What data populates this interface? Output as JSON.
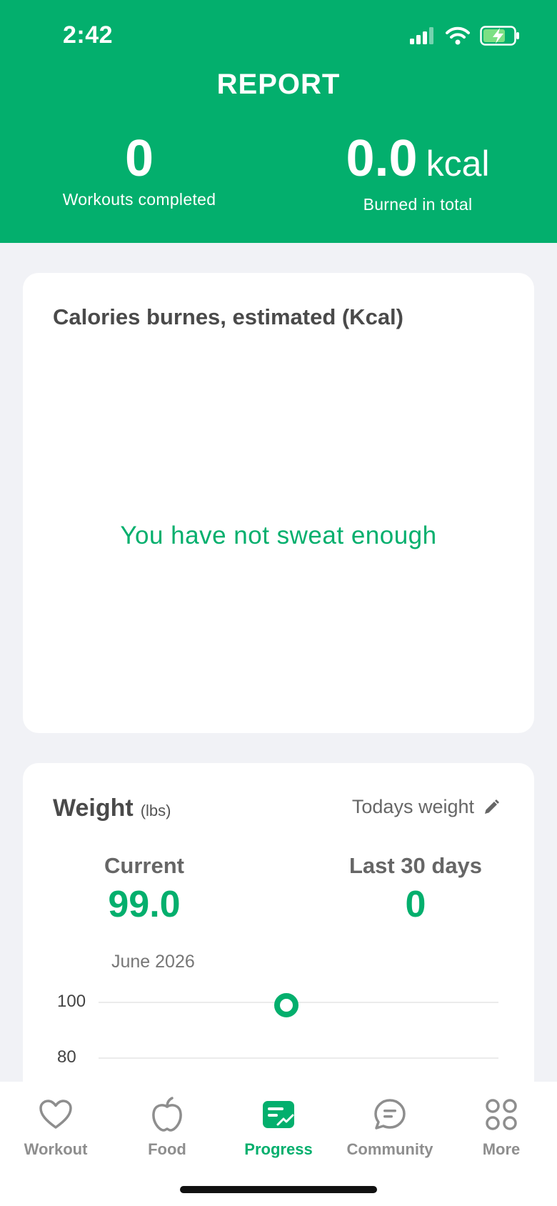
{
  "status_bar": {
    "time": "2:42"
  },
  "header": {
    "title": "REPORT",
    "workouts": {
      "value": "0",
      "label": "Workouts completed"
    },
    "burned": {
      "value": "0.0",
      "unit": "kcal",
      "label": "Burned in total"
    }
  },
  "calories_card": {
    "title": "Calories burnes, estimated (Kcal)",
    "empty_message": "You have not sweat enough"
  },
  "weight_card": {
    "title": "Weight",
    "unit": "(lbs)",
    "todays_weight": "Todays weight",
    "current": {
      "label": "Current",
      "value": "99.0"
    },
    "last30": {
      "label": "Last 30 days",
      "value": "0"
    },
    "month": "June 2026",
    "y_ticks": [
      "100",
      "80"
    ],
    "point_value": 99.0
  },
  "tabbar": {
    "tabs": [
      {
        "label": "Workout",
        "icon": "heart-icon",
        "active": false
      },
      {
        "label": "Food",
        "icon": "apple-icon",
        "active": false
      },
      {
        "label": "Progress",
        "icon": "progress-icon",
        "active": true
      },
      {
        "label": "Community",
        "icon": "chat-icon",
        "active": false
      },
      {
        "label": "More",
        "icon": "grid-icon",
        "active": false
      }
    ]
  },
  "colors": {
    "brand": "#03AF6D",
    "background": "#F1F2F6"
  }
}
